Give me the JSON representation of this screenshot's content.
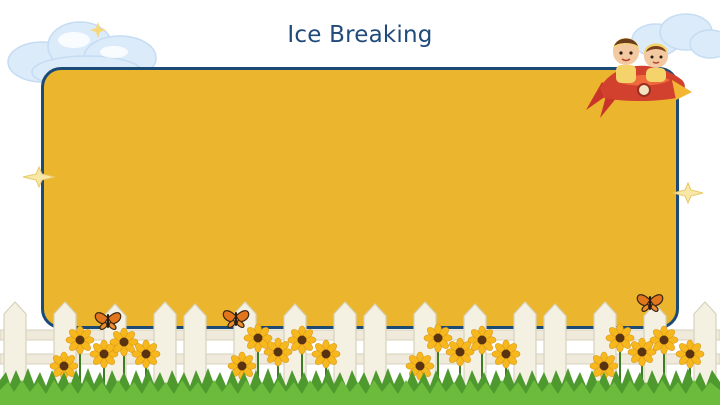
{
  "slide": {
    "title": "Ice Breaking",
    "colors": {
      "panel_fill": "#ebb52d",
      "panel_border": "#1b4a75",
      "title_text": "#1f4a7a",
      "fence": "#f4f1e3",
      "grass": "#4e9a2f",
      "flower_petal": "#f6b81c",
      "flower_center": "#5a3312",
      "butterfly": "#e2761d",
      "cloud": "#dcebfa"
    },
    "decorations": [
      "cloud-left",
      "cloud-right",
      "kids-rocket",
      "sparkle-left",
      "sparkle-right",
      "butterfly",
      "picket-fence",
      "sunflowers",
      "grass"
    ]
  }
}
